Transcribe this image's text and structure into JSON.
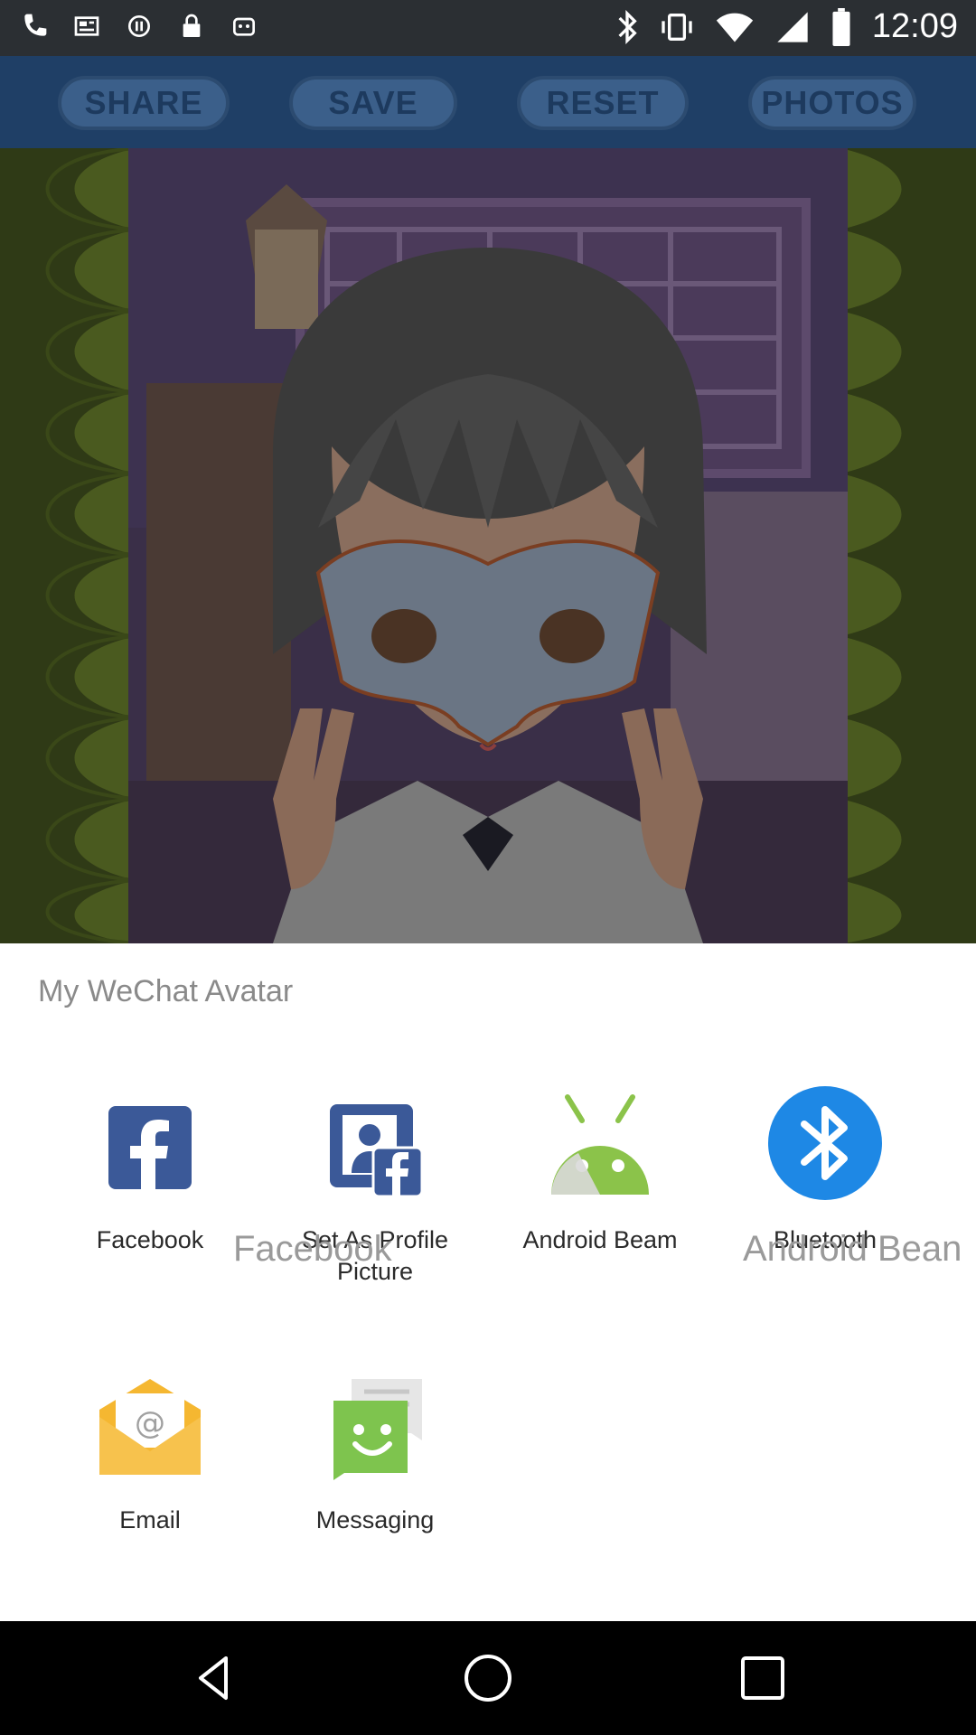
{
  "status_bar": {
    "time": "12:09",
    "left_icons": [
      "phone-icon",
      "news-icon",
      "sync-icon",
      "lock-icon",
      "android-icon"
    ],
    "right_icons": [
      "bluetooth-icon",
      "vibrate-icon",
      "wifi-icon",
      "signal-icon",
      "battery-icon"
    ]
  },
  "toolbar": {
    "buttons": [
      "SHARE",
      "SAVE",
      "RESET",
      "PHOTOS"
    ]
  },
  "share_sheet": {
    "title": "My WeChat Avatar",
    "apps": [
      {
        "label": "Facebook",
        "icon": "facebook-icon"
      },
      {
        "label": "Set As Profile\nPicture",
        "icon": "facebook-profile-icon"
      },
      {
        "label": "Android Beam",
        "icon": "android-beam-icon"
      },
      {
        "label": "Bluetooth",
        "icon": "bluetooth-icon"
      },
      {
        "label": "Email",
        "icon": "email-icon"
      },
      {
        "label": "Messaging",
        "icon": "messaging-icon"
      }
    ],
    "ghost_labels": [
      "Facebook",
      "Android Bean"
    ]
  },
  "colors": {
    "facebook": "#3b5998",
    "android_green": "#8bc34a",
    "bluetooth": "#1e88e5",
    "email_yellow": "#f5b731",
    "messaging_green": "#7ec44e"
  },
  "nav_bar": {
    "icons": [
      "back-icon",
      "home-icon",
      "recents-icon"
    ]
  }
}
